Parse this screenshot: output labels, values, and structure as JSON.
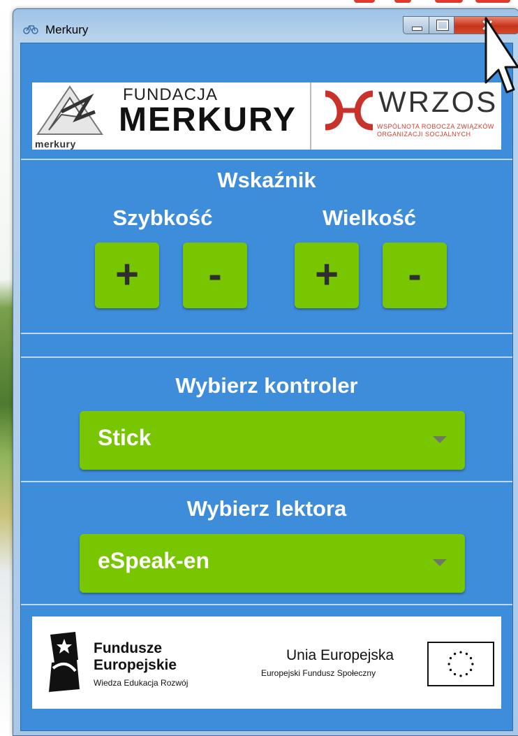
{
  "window": {
    "title": "Merkury",
    "controls": {
      "close": "✕"
    }
  },
  "logos": {
    "merkury_small": "merkury",
    "fundacja": "FUNDACJA",
    "merkury_big": "MERKURY",
    "wrzos": "WRZOS",
    "wrzos_sub_line1": "WSPÓLNOTA ROBOCZA ZWIĄZKÓW",
    "wrzos_sub_line2": "ORGANIZACJI SOCJALNYCH"
  },
  "pointer": {
    "title": "Wskaźnik",
    "speed_label": "Szybkość",
    "size_label": "Wielkość",
    "plus": "+",
    "minus": "-"
  },
  "controller": {
    "title": "Wybierz kontroler",
    "selected": "Stick"
  },
  "reader": {
    "title": "Wybierz lektora",
    "selected": "eSpeak-en"
  },
  "footer": {
    "fe_line1": "Fundusze",
    "fe_line2": "Europejskie",
    "fe_sub": "Wiedza Edukacja Rozwój",
    "ue_title": "Unia Europejska",
    "ue_sub": "Europejski Fundusz Społeczny"
  },
  "colors": {
    "client_bg": "#3d8ddb",
    "button_green": "#78c600",
    "accent_red": "#d63a2a"
  }
}
